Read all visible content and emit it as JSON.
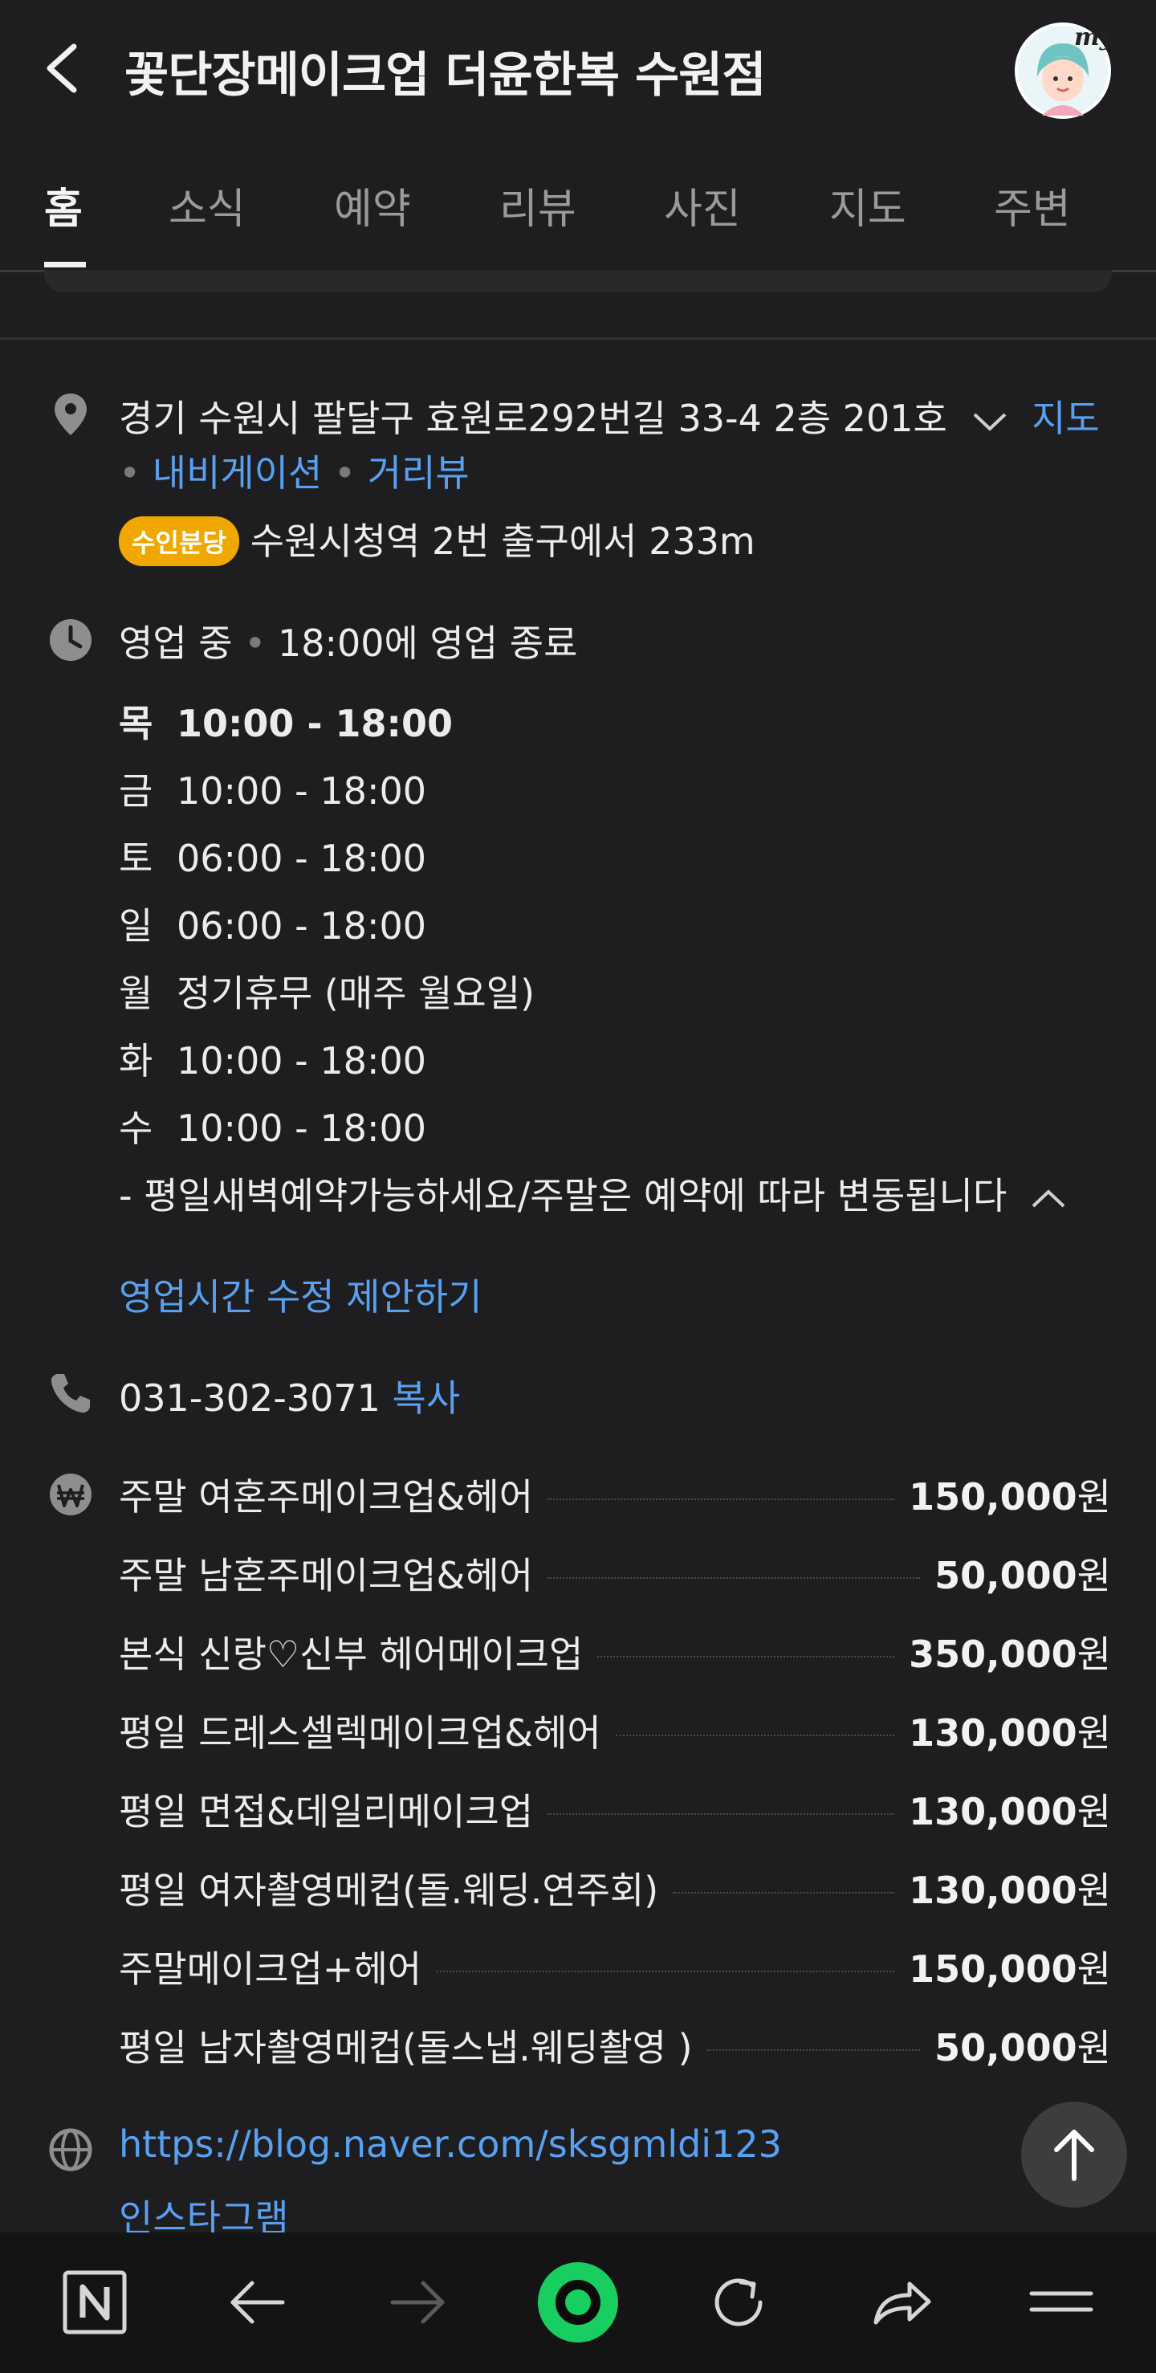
{
  "header": {
    "title": "꽃단장메이크업 더윤한복 수원점",
    "avatar_badge": "my"
  },
  "tabs": [
    {
      "label": "홈",
      "active": true
    },
    {
      "label": "소식"
    },
    {
      "label": "예약"
    },
    {
      "label": "리뷰"
    },
    {
      "label": "사진"
    },
    {
      "label": "지도"
    },
    {
      "label": "주변"
    }
  ],
  "address": {
    "text": "경기 수원시 팔달구 효원로292번길 33-4 2층 201호",
    "map_link": "지도",
    "navigation_link": "내비게이션",
    "street_view_link": "거리뷰",
    "badge": "수인분당",
    "station_text": "수원시청역 2번 출구에서 233m"
  },
  "hours": {
    "status": "영업 중",
    "status_detail": "18:00에 영업 종료",
    "days": [
      {
        "day": "목",
        "time": "10:00 - 18:00"
      },
      {
        "day": "금",
        "time": "10:00 - 18:00"
      },
      {
        "day": "토",
        "time": "06:00 - 18:00"
      },
      {
        "day": "일",
        "time": "06:00 - 18:00"
      },
      {
        "day": "월",
        "time": "정기휴무 (매주 월요일)"
      },
      {
        "day": "화",
        "time": "10:00 - 18:00"
      },
      {
        "day": "수",
        "time": "10:00 - 18:00"
      }
    ],
    "note": "- 평일새벽예약가능하세요/주말은 예약에 따라 변동됩니다",
    "suggest_edit": "영업시간 수정 제안하기"
  },
  "phone": {
    "number": "031-302-3071",
    "copy_label": "복사"
  },
  "menu": [
    {
      "name": "주말 여혼주메이크업&헤어",
      "price": "150,000",
      "unit": "원"
    },
    {
      "name": "주말 남혼주메이크업&헤어",
      "price": "50,000",
      "unit": "원"
    },
    {
      "name": "본식 신랑♡신부 헤어메이크업",
      "price": "350,000",
      "unit": "원"
    },
    {
      "name": "평일 드레스셀렉메이크업&헤어",
      "price": "130,000",
      "unit": "원"
    },
    {
      "name": "평일 면접&데일리메이크업",
      "price": "130,000",
      "unit": "원"
    },
    {
      "name": "평일 여자촬영메컵(돌.웨딩.연주회)",
      "price": "130,000",
      "unit": "원"
    },
    {
      "name": "주말메이크업+헤어",
      "price": "150,000",
      "unit": "원"
    },
    {
      "name": "평일 남자촬영메컵(돌스냅.웨딩촬영 )",
      "price": "50,000",
      "unit": "원"
    }
  ],
  "website": {
    "url": "https://blog.naver.com/sksgmldi123",
    "instagram": "인스타그램"
  },
  "colors": {
    "background": "#1e1e20",
    "link": "#5aa0f0",
    "badge": "#f0a800",
    "browser_home_ring": "#19ce60"
  },
  "icons": {
    "address": "location-pin-icon",
    "hours": "clock-icon",
    "phone": "phone-icon",
    "price": "won-icon",
    "website": "globe-icon"
  }
}
